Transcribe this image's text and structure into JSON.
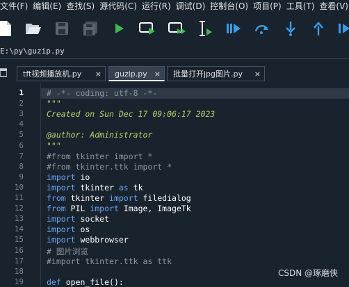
{
  "menu": [
    "文件(F)",
    "编辑(E)",
    "查找(S)",
    "源代码(C)",
    "运行(R)",
    "调试(D)",
    "控制台(O)",
    "项目(P)",
    "工具(T)",
    "查看(V)"
  ],
  "toolbar": {
    "icons": [
      "new-file-icon",
      "open-folder-icon",
      "save-icon",
      "save-all-icon",
      "run-icon",
      "run-cell-icon",
      "run-cell-advance-icon",
      "run-selection-icon",
      "debug-icon",
      "step-icon",
      "step-into-icon",
      "step-return-icon",
      "continue-icon"
    ]
  },
  "path": "E:\\py\\guzip.py",
  "tabs": [
    {
      "label": "tft视频播放机.py",
      "close": "×",
      "active": false
    },
    {
      "label": "guzip.py",
      "close": "×",
      "active": true
    },
    {
      "label": "批量打开jpg图片.py",
      "close": "×",
      "active": false
    }
  ],
  "editor": {
    "line_numbers": [
      "1",
      "2",
      "3",
      "4",
      "5",
      "6",
      "7",
      "8",
      "9",
      "10",
      "11",
      "12",
      "13",
      "14",
      "15",
      "16",
      "17",
      "18",
      "19"
    ],
    "lines": [
      {
        "parts": [
          {
            "t": "# -*- coding: utf-8 -*-",
            "c": "cm"
          }
        ]
      },
      {
        "parts": [
          {
            "t": "\"\"\"",
            "c": "st"
          }
        ]
      },
      {
        "parts": [
          {
            "t": "Created on Sun Dec 17 09:06:17 2023",
            "c": "st"
          }
        ]
      },
      {
        "parts": []
      },
      {
        "parts": [
          {
            "t": "@author: Administrator",
            "c": "st"
          }
        ]
      },
      {
        "parts": [
          {
            "t": "\"\"\"",
            "c": "st"
          }
        ]
      },
      {
        "parts": [
          {
            "t": "#from tkinter import *",
            "c": "cm"
          }
        ]
      },
      {
        "parts": [
          {
            "t": "#from tkinter.ttk import *",
            "c": "cm"
          }
        ]
      },
      {
        "parts": [
          {
            "t": "import",
            "c": "k"
          },
          {
            "t": " io",
            "c": ""
          }
        ]
      },
      {
        "parts": [
          {
            "t": "import",
            "c": "k"
          },
          {
            "t": " tkinter ",
            "c": ""
          },
          {
            "t": "as",
            "c": "k"
          },
          {
            "t": " tk",
            "c": ""
          }
        ]
      },
      {
        "parts": [
          {
            "t": "from",
            "c": "k"
          },
          {
            "t": " tkinter ",
            "c": ""
          },
          {
            "t": "import",
            "c": "k"
          },
          {
            "t": " filedialog",
            "c": ""
          }
        ]
      },
      {
        "parts": [
          {
            "t": "from",
            "c": "k"
          },
          {
            "t": " PIL ",
            "c": ""
          },
          {
            "t": "import",
            "c": "k"
          },
          {
            "t": " Image, ImageTk",
            "c": ""
          }
        ]
      },
      {
        "parts": [
          {
            "t": "import",
            "c": "k"
          },
          {
            "t": " socket",
            "c": ""
          }
        ]
      },
      {
        "parts": [
          {
            "t": "import",
            "c": "k"
          },
          {
            "t": " os",
            "c": ""
          }
        ]
      },
      {
        "parts": [
          {
            "t": "import",
            "c": "k"
          },
          {
            "t": " webbrowser",
            "c": ""
          }
        ]
      },
      {
        "parts": [
          {
            "t": "# 图片浏览",
            "c": "cm"
          }
        ]
      },
      {
        "parts": [
          {
            "t": "#import tkinter.ttk as ttk",
            "c": "cm"
          }
        ]
      },
      {
        "parts": []
      },
      {
        "parts": [
          {
            "t": "def",
            "c": "k"
          },
          {
            "t": " ",
            "c": ""
          },
          {
            "t": "open_file",
            "c": ""
          },
          {
            "t": "():",
            "c": ""
          }
        ]
      }
    ]
  },
  "watermark": "CSDN @琢磨侠",
  "colors": {
    "background": "#19232d",
    "keyword": "#6da5f7",
    "comment": "#8d96a0",
    "string": "#b5d36a",
    "icon_blue": "#3c9be6"
  }
}
